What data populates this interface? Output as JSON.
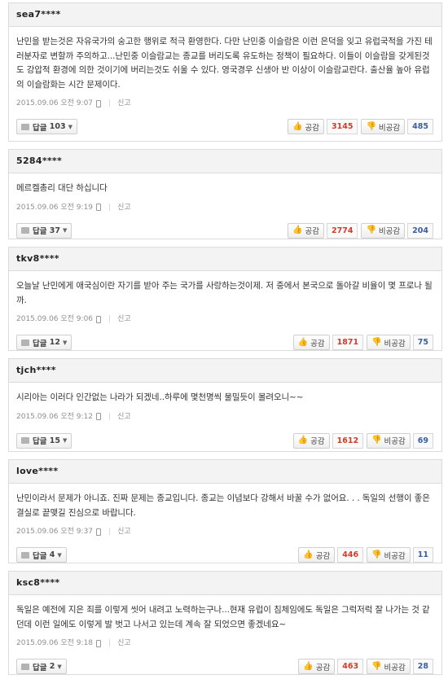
{
  "labels": {
    "reply": "답글",
    "like": "공감",
    "dislike": "비공감",
    "report": "신고"
  },
  "comments": [
    {
      "author": "sea7****",
      "text": "난민을 받는것은 자유국가의 숭고한 행위로 적극 환영한다. 다만 난민중 이슬람은 이런 은덕을 잊고 유럽국적을 가진 테러분자로 변할까 주의하고...난민중 이슬람교는 종교를 버리도록 유도하는 정책이 필요하다. 이들이 이슬람을 갖게된것도 강압적 환경에 의한 것이기에 버리는것도 쉬울 수 있다. 영국경우 신생아 반 이상이 이슬람교란다. 출산율 높아 유럽의 이슬람화는 시간 문제이다.",
      "date": "2015.09.06 오전 9:07",
      "replies": "103",
      "likes": "3145",
      "dislikes": "485"
    },
    {
      "author": "5284****",
      "text": "메르켈총리 대단 하십니다",
      "date": "2015.09.06 오전 9:19",
      "replies": "37",
      "likes": "2774",
      "dislikes": "204"
    },
    {
      "author": "tkv8****",
      "text": "오늘날 난민에게 애국심이란 자기를 받아 주는 국가를 사랑하는것이제. 저 중에서 본국으로 돌아갈 비율이 몇 프로나 될까.",
      "date": "2015.09.06 오전 9:06",
      "replies": "12",
      "likes": "1871",
      "dislikes": "75"
    },
    {
      "author": "tjch****",
      "text": "시리아는 이러다 인간없는 나라가 되겠네..하루에 몇천명씩 물밀듯이 몰려오니~~",
      "date": "2015.09.06 오전 9:12",
      "replies": "15",
      "likes": "1612",
      "dislikes": "69"
    },
    {
      "author": "love****",
      "text": "난민이라서 문제가 아니죠. 진짜 문제는 종교입니다. 종교는 이념보다 강해서 바꿀 수가 없어요. . . 독일의 선행이 좋은 결실로 끝맺길 진심으로 바랍니다.",
      "date": "2015.09.06 오전 9:37",
      "replies": "4",
      "likes": "446",
      "dislikes": "11"
    },
    {
      "author": "ksc8****",
      "text": "독일은 예전에 지은 죄를 이렇게 씻어 내려고 노력하는구나...현재 유럽이 침체임에도 독일은 그럭저럭 잘 나가는 것 같던데 이런 일에도 이렇게 발 벗고 나서고 있는데 계속 잘 되었으면 좋겠네요~",
      "date": "2015.09.06 오전 9:18",
      "replies": "2",
      "likes": "463",
      "dislikes": "28"
    }
  ]
}
